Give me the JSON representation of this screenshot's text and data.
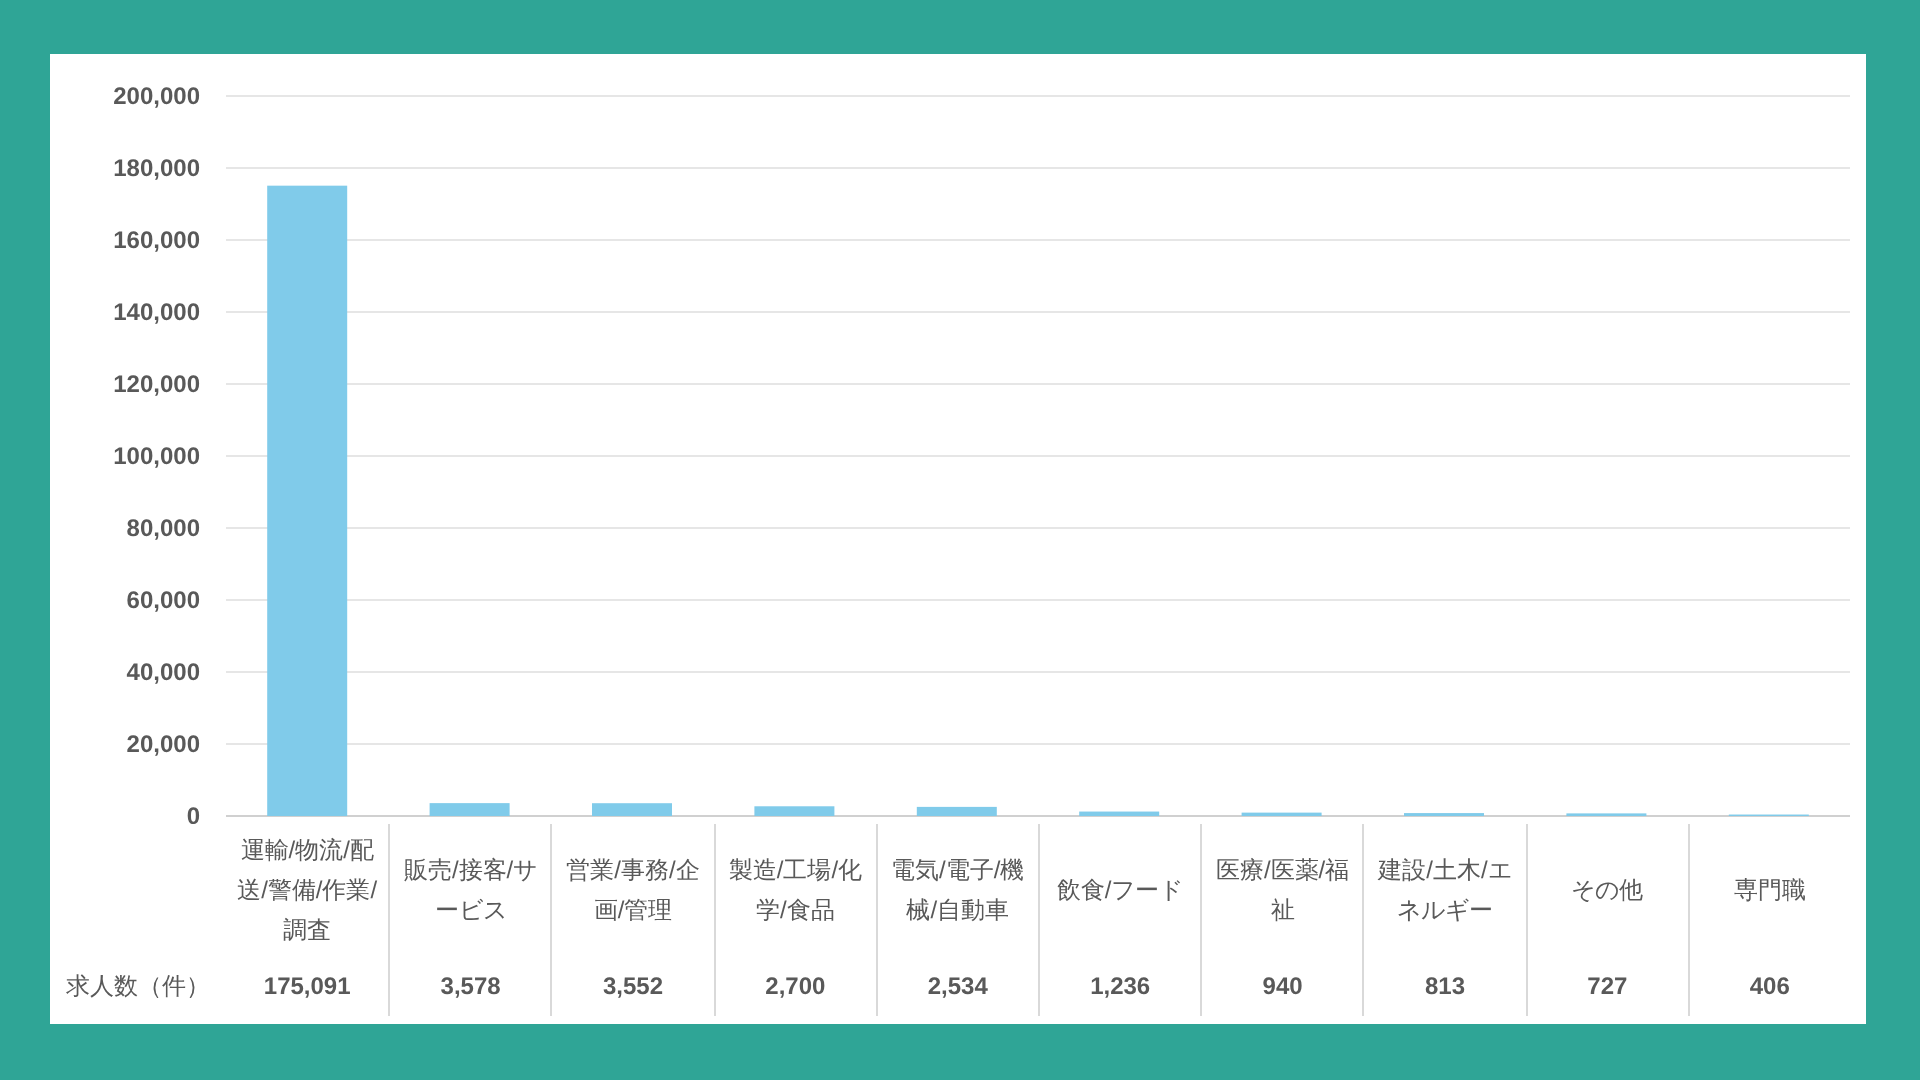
{
  "chart_data": {
    "type": "bar",
    "categories": [
      "運輸/物流/配送/警備/作業/調査",
      "販売/接客/サービス",
      "営業/事務/企画/管理",
      "製造/工場/化学/食品",
      "電気/電子/機械/自動車",
      "飲食/フード",
      "医療/医薬/福祉",
      "建設/土木/エネルギー",
      "その他",
      "専門職"
    ],
    "series": [
      {
        "name": "求人数（件）",
        "color": "#80cbea",
        "values": [
          175091,
          3578,
          3552,
          2700,
          2534,
          1236,
          940,
          813,
          727,
          406
        ]
      }
    ],
    "ylim": [
      0,
      200000
    ],
    "grid": true,
    "yticks": [
      {
        "value": 0,
        "label": "0"
      },
      {
        "value": 20000,
        "label": "20,000"
      },
      {
        "value": 40000,
        "label": "40,000"
      },
      {
        "value": 60000,
        "label": "60,000"
      },
      {
        "value": 80000,
        "label": "80,000"
      },
      {
        "value": 100000,
        "label": "100,000"
      },
      {
        "value": 120000,
        "label": "120,000"
      },
      {
        "value": 140000,
        "label": "140,000"
      },
      {
        "value": 160000,
        "label": "160,000"
      },
      {
        "value": 180000,
        "label": "180,000"
      },
      {
        "value": 200000,
        "label": "200,000"
      }
    ],
    "value_labels": [
      "175,091",
      "3,578",
      "3,552",
      "2,700",
      "2,534",
      "1,236",
      "940",
      "813",
      "727",
      "406"
    ]
  }
}
